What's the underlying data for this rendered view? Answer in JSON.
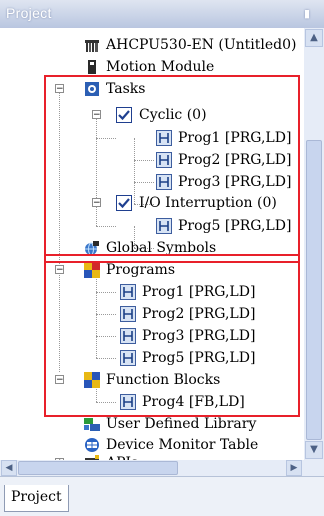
{
  "panel": {
    "title": "Project",
    "pin_icon": "pin-icon"
  },
  "tree": {
    "device": "AHCPU530-EN  (Untitled0)",
    "motion_module": "Motion Module",
    "tasks": "Tasks",
    "cyclic": "Cyclic (0)",
    "cyclic_progs": [
      "Prog1 [PRG,LD]",
      "Prog2 [PRG,LD]",
      "Prog3 [PRG,LD]"
    ],
    "io_interruption": "I/O Interruption (0)",
    "io_progs": [
      "Prog5 [PRG,LD]"
    ],
    "global_symbols": "Global Symbols",
    "programs": "Programs",
    "program_items": [
      "Prog1 [PRG,LD]",
      "Prog2 [PRG,LD]",
      "Prog3 [PRG,LD]",
      "Prog5 [PRG,LD]"
    ],
    "function_blocks": "Function Blocks",
    "fb_items": [
      "Prog4 [FB,LD]"
    ],
    "user_defined_library": "User Defined Library",
    "device_monitor_table": "Device Monitor Table",
    "apis": "APIs"
  },
  "expanders": {
    "minus": "−",
    "plus": "+"
  },
  "scroll": {
    "up": "▲",
    "down": "▼",
    "left": "◀",
    "right": "▶"
  },
  "tabs": [
    "Project"
  ],
  "colors": {
    "highlight_box": "#e8202a",
    "title_bar": "#c3cfe6"
  }
}
